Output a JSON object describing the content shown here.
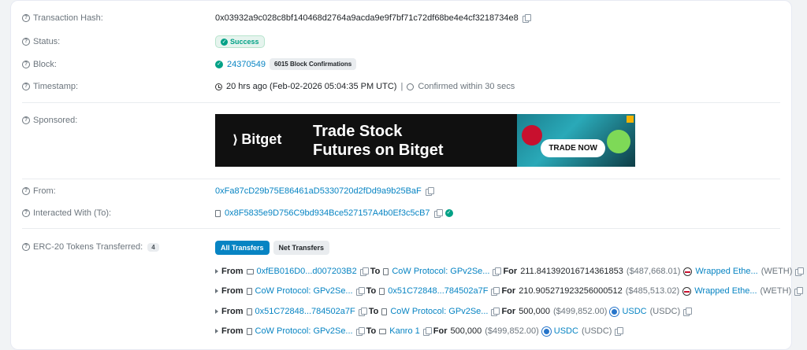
{
  "transaction_hash": {
    "label": "Transaction Hash:",
    "value": "0x03932a9c028c8bf140468d2764a9acda9e9f7bf71c72df68be4e4cf3218734e8"
  },
  "status": {
    "label": "Status:",
    "value": "Success"
  },
  "block": {
    "label": "Block:",
    "number": "24370549",
    "confirmations": "6015 Block Confirmations"
  },
  "timestamp": {
    "label": "Timestamp:",
    "value": "20 hrs ago (Feb-02-2026 05:04:35 PM UTC)",
    "separator": "|",
    "confirmed": "Confirmed within 30 secs"
  },
  "sponsored": {
    "label": "Sponsored:",
    "brand": "Bitget",
    "headline_line1": "Trade Stock",
    "headline_line2": "Futures on Bitget",
    "cta": "TRADE NOW"
  },
  "from": {
    "label": "From:",
    "address": "0xFa87cD29b75E86461aD5330720d2fDd9a9b25BaF"
  },
  "interacted_with": {
    "label": "Interacted With (To):",
    "address": "0x8F5835e9D756C9bd934Bce527157A4b0Ef3c5cB7"
  },
  "erc20": {
    "label": "ERC-20 Tokens Transferred:",
    "count": "4",
    "tabs": [
      {
        "label": "All Transfers",
        "active": true
      },
      {
        "label": "Net Transfers",
        "active": false
      }
    ],
    "transfers": [
      {
        "from_label": "From",
        "from": "0xfEB016D0...d007203B2",
        "to_label": "To",
        "to": "CoW Protocol: GPv2Se...",
        "for_label": "For",
        "amount": "211.841392016714361853",
        "usd": "($487,668.01)",
        "token": "Wrapped Ethe...",
        "symbol": "(WETH)"
      },
      {
        "from_label": "From",
        "from": "CoW Protocol: GPv2Se...",
        "to_label": "To",
        "to": "0x51C72848...784502a7F",
        "for_label": "For",
        "amount": "210.905271923256000512",
        "usd": "($485,513.02)",
        "token": "Wrapped Ethe...",
        "symbol": "(WETH)"
      },
      {
        "from_label": "From",
        "from": "0x51C72848...784502a7F",
        "to_label": "To",
        "to": "CoW Protocol: GPv2Se...",
        "for_label": "For",
        "amount": "500,000",
        "usd": "($499,852.00)",
        "token": "USDC",
        "symbol": "(USDC)"
      },
      {
        "from_label": "From",
        "from": "CoW Protocol: GPv2Se...",
        "to_label": "To",
        "to": "Kanro 1",
        "for_label": "For",
        "amount": "500,000",
        "usd": "($499,852.00)",
        "token": "USDC",
        "symbol": "(USDC)"
      }
    ]
  },
  "colors": {
    "link": "#0784c3",
    "success": "#00a186",
    "muted": "#6c757d"
  }
}
